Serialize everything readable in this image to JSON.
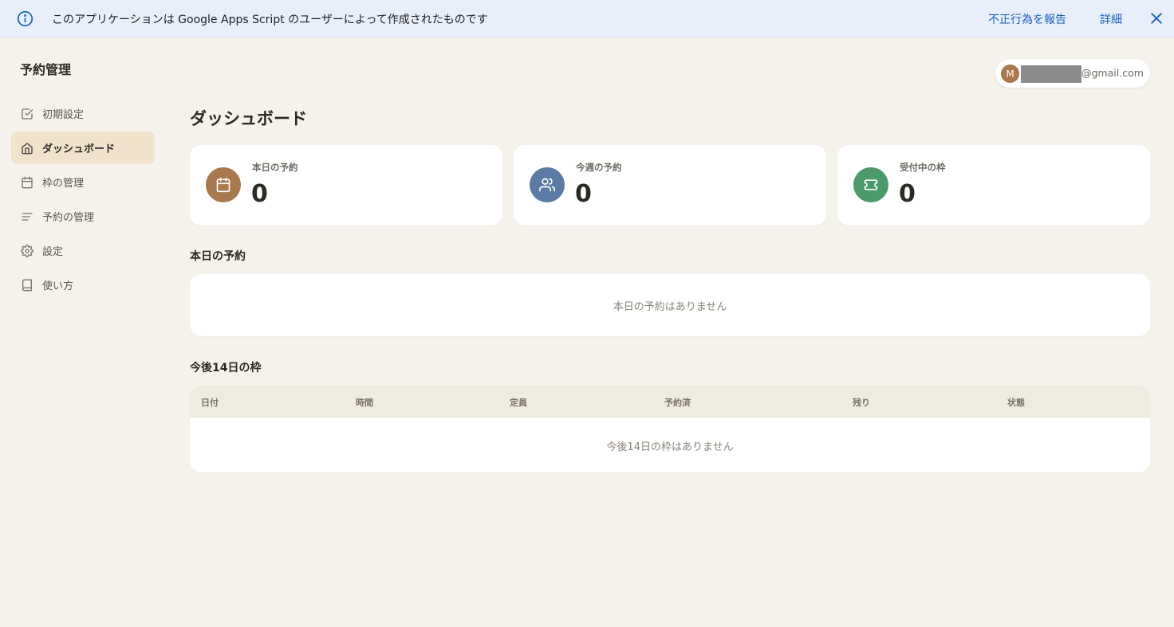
{
  "banner": {
    "message": "このアプリケーションは Google Apps Script のユーザーによって作成されたものです",
    "report_link": "不正行為を報告",
    "details_link": "詳細"
  },
  "sidebar": {
    "app_title": "予約管理",
    "items": [
      {
        "label": "初期設定",
        "icon": "checkbox-icon",
        "active": false
      },
      {
        "label": "ダッシュボード",
        "icon": "home-icon",
        "active": true
      },
      {
        "label": "枠の管理",
        "icon": "calendar-icon",
        "active": false
      },
      {
        "label": "予約の管理",
        "icon": "list-icon",
        "active": false
      },
      {
        "label": "設定",
        "icon": "gear-icon",
        "active": false
      },
      {
        "label": "使い方",
        "icon": "book-icon",
        "active": false
      }
    ]
  },
  "account": {
    "initial": "M",
    "email_suffix": "@gmail.com"
  },
  "main": {
    "page_title": "ダッシュボード",
    "stats": [
      {
        "label": "本日の予約",
        "value": "0",
        "icon": "calendar-icon",
        "color": "#a9784c"
      },
      {
        "label": "今週の予約",
        "value": "0",
        "icon": "users-icon",
        "color": "#5a7ba3"
      },
      {
        "label": "受付中の枠",
        "value": "0",
        "icon": "ticket-icon",
        "color": "#4a9a6a"
      }
    ],
    "today": {
      "title": "本日の予約",
      "empty_message": "本日の予約はありません"
    },
    "upcoming": {
      "title": "今後14日の枠",
      "columns": [
        "日付",
        "時間",
        "定員",
        "予約済",
        "残り",
        "状態"
      ],
      "empty_message": "今後14日の枠はありません"
    }
  },
  "colors": {
    "background": "#f5f2ec",
    "active_nav": "#f1e2cc",
    "link": "#1a5fc4"
  }
}
